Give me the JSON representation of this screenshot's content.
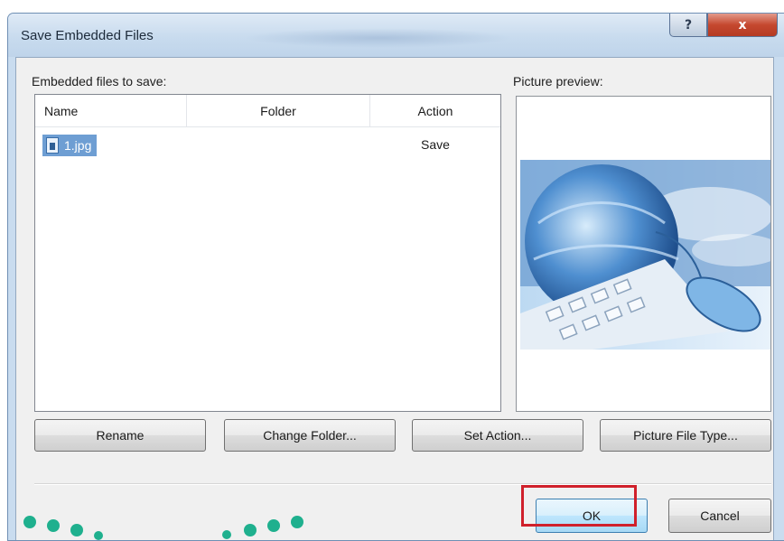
{
  "dialog": {
    "title": "Save Embedded Files",
    "help_glyph": "?",
    "close_glyph": "x"
  },
  "files_label": "Embedded files to save:",
  "preview_label": "Picture preview:",
  "table": {
    "columns": [
      "Name",
      "Folder",
      "Action"
    ],
    "rows": [
      {
        "name": "1.jpg",
        "folder": "",
        "action": "Save"
      }
    ]
  },
  "buttons": {
    "rename": "Rename",
    "change_folder": "Change Folder...",
    "set_action": "Set Action...",
    "picture_file_type": "Picture File Type...",
    "ok": "OK",
    "cancel": "Cancel"
  },
  "colors": {
    "ok_highlight": "#d0202b",
    "selection": "#6e9ed3",
    "decor_dots": "#1fb08e"
  }
}
